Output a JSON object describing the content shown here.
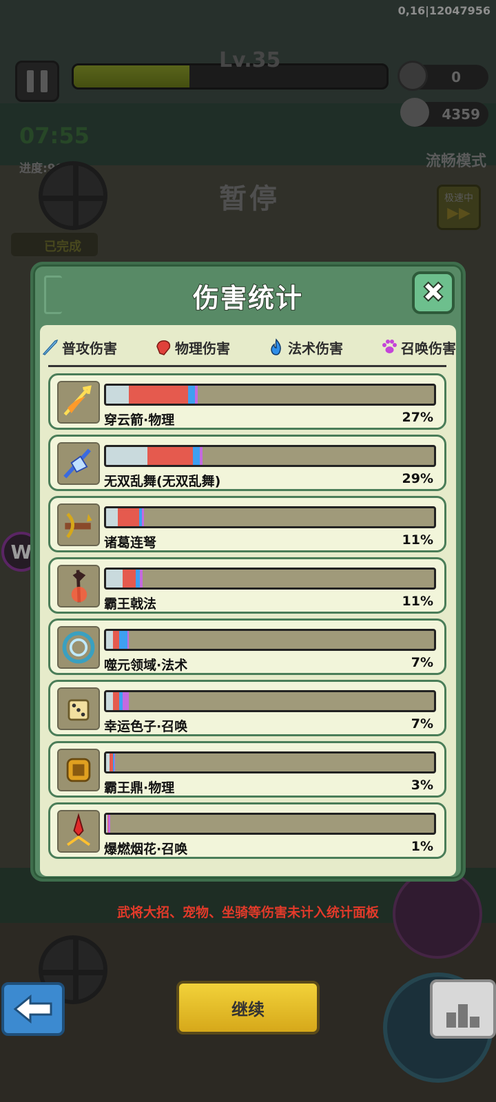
{
  "status_bar": {
    "info": "0,16|12047956"
  },
  "hud": {
    "level": "Lv.35",
    "xp_fraction": 0.37,
    "coins": "0",
    "kills": "4359",
    "timer": "07:55",
    "progress": "进度:99%",
    "mode": "流畅模式",
    "paused": "暂停",
    "speed_label": "极速中",
    "quest_done": "已完成"
  },
  "panel": {
    "title": "伤害统计",
    "close_icon": "close-icon",
    "legend": [
      {
        "label": "普攻伤害",
        "icon": "sword-icon",
        "color": "#7ec3f0"
      },
      {
        "label": "物理伤害",
        "icon": "fist-icon",
        "color": "#e0413a"
      },
      {
        "label": "法术伤害",
        "icon": "flame-icon",
        "color": "#2f8ee8"
      },
      {
        "label": "召唤伤害",
        "icon": "paw-icon",
        "color": "#c444d8"
      }
    ],
    "rows": [
      {
        "name": "穿云箭·物理",
        "pct": "27%",
        "icon": "arrow-wings-icon",
        "segments": {
          "normal": 0.07,
          "physical": 0.18,
          "magic": 0.02,
          "summon": 0.01
        }
      },
      {
        "name": "无双乱舞(无双乱舞)",
        "pct": "29%",
        "icon": "crystal-sword-icon",
        "segments": {
          "normal": 0.125,
          "physical": 0.14,
          "magic": 0.02,
          "summon": 0.01
        }
      },
      {
        "name": "诸葛连弩",
        "pct": "11%",
        "icon": "crossbow-icon",
        "segments": {
          "normal": 0.035,
          "physical": 0.065,
          "magic": 0.01,
          "summon": 0.005
        }
      },
      {
        "name": "霸王戟法",
        "pct": "11%",
        "icon": "halberd-icon",
        "segments": {
          "normal": 0.05,
          "physical": 0.04,
          "magic": 0.012,
          "summon": 0.01
        }
      },
      {
        "name": "噬元领域·法术",
        "pct": "7%",
        "icon": "vortex-icon",
        "segments": {
          "normal": 0.02,
          "physical": 0.02,
          "magic": 0.025,
          "summon": 0.005
        }
      },
      {
        "name": "幸运色子·召唤",
        "pct": "7%",
        "icon": "dice-icon",
        "segments": {
          "normal": 0.02,
          "physical": 0.02,
          "magic": 0.01,
          "summon": 0.02
        }
      },
      {
        "name": "霸王鼎·物理",
        "pct": "3%",
        "icon": "cauldron-icon",
        "segments": {
          "normal": 0.01,
          "physical": 0.01,
          "magic": 0.005,
          "summon": 0.003
        }
      },
      {
        "name": "爆燃烟花·召唤",
        "pct": "1%",
        "icon": "firework-icon",
        "segments": {
          "normal": 0.004,
          "physical": 0.002,
          "magic": 0.0,
          "summon": 0.006
        }
      }
    ]
  },
  "footer": {
    "note": "武将大招、宠物、坐骑等伤害未计入统计面板",
    "continue_label": "继续"
  }
}
